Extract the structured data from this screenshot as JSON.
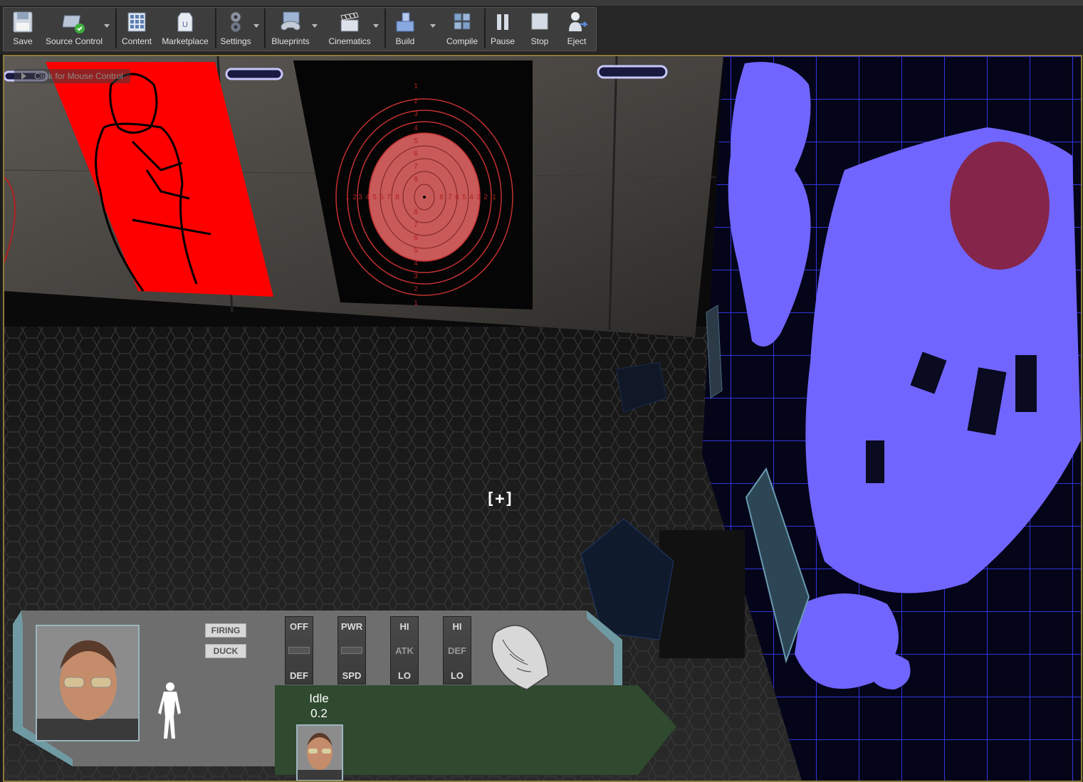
{
  "toolbar": {
    "buttons": [
      {
        "label": "Save",
        "icon": "floppy-disk-icon"
      },
      {
        "label": "Source Control",
        "icon": "source-control-icon"
      },
      {
        "label": "Content",
        "icon": "content-browser-icon"
      },
      {
        "label": "Marketplace",
        "icon": "marketplace-icon"
      },
      {
        "label": "Settings",
        "icon": "settings-gears-icon"
      },
      {
        "label": "Blueprints",
        "icon": "blueprints-controller-icon"
      },
      {
        "label": "Cinematics",
        "icon": "clapperboard-icon"
      },
      {
        "label": "Build",
        "icon": "build-blocks-icon"
      },
      {
        "label": "Compile",
        "icon": "compile-cubes-icon"
      },
      {
        "label": "Pause",
        "icon": "pause-icon"
      },
      {
        "label": "Stop",
        "icon": "stop-icon"
      },
      {
        "label": "Eject",
        "icon": "eject-person-icon"
      }
    ]
  },
  "viewport": {
    "mouse_hint": "Click for Mouse Control",
    "crosshair": "[+]",
    "target_numbers_vertical": [
      "1",
      "2",
      "3",
      "4",
      "5",
      "6",
      "7",
      "8",
      "8",
      "7",
      "6",
      "5",
      "4",
      "3",
      "2",
      "1"
    ],
    "target_numbers_horizontal": [
      "1",
      "2",
      "3",
      "4",
      "5",
      "6",
      "7",
      "8",
      "8",
      "7",
      "6",
      "5",
      "4",
      "3",
      "2",
      "1"
    ]
  },
  "hud": {
    "chips": {
      "firing": "FIRING",
      "duck": "DUCK"
    },
    "sliders": [
      {
        "top": "OFF",
        "mid": "",
        "bottom": "DEF"
      },
      {
        "top": "PWR",
        "mid": "",
        "bottom": "SPD"
      },
      {
        "top": "HI",
        "mid": "ATK",
        "bottom": "LO"
      },
      {
        "top": "HI",
        "mid": "DEF",
        "bottom": "LO"
      }
    ],
    "animation": {
      "state": "Idle",
      "value": "0.2"
    }
  },
  "colors": {
    "poster_red": "#ff0000",
    "target_fill": "#c85a5a",
    "map_blue": "#7066ff",
    "hud_panel": "#6e6e6e",
    "anim_bar": "#2f4a2f",
    "hud_teal": "#6f9aa3"
  }
}
